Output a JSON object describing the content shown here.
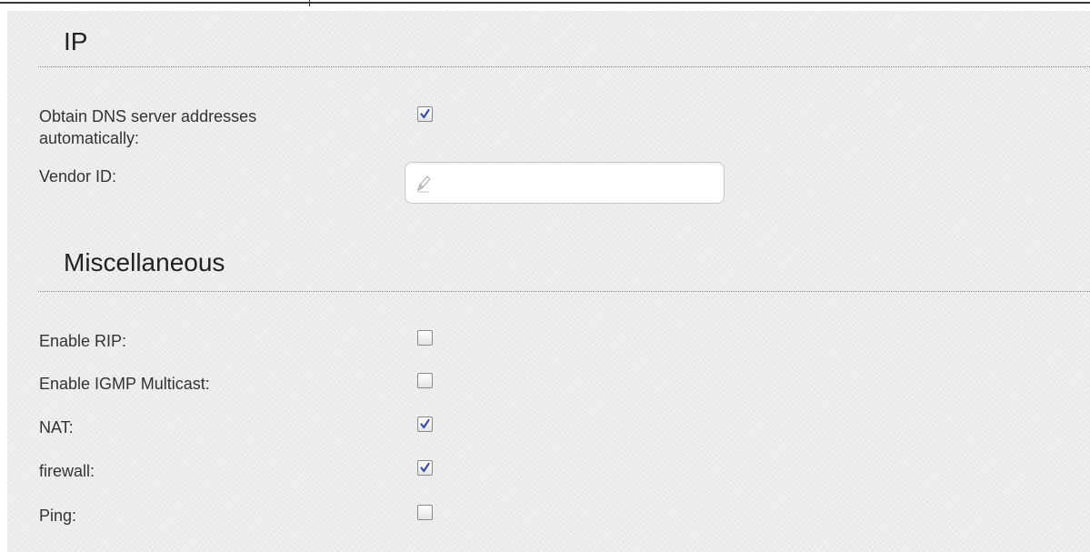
{
  "sections": {
    "ip": {
      "title": "IP",
      "dns_auto": {
        "label_line1": "Obtain DNS server addresses",
        "label_line2": "automatically:",
        "checked": true
      },
      "vendor_id": {
        "label": "Vendor ID:",
        "value": "",
        "icon": "pencil-icon"
      }
    },
    "misc": {
      "title": "Miscellaneous",
      "items": [
        {
          "label": "Enable RIP:",
          "checked": false
        },
        {
          "label": "Enable IGMP Multicast:",
          "checked": false
        },
        {
          "label": "NAT:",
          "checked": true
        },
        {
          "label": "firewall:",
          "checked": true
        },
        {
          "label": "Ping:",
          "checked": false
        }
      ]
    }
  },
  "colors": {
    "panel_background": "#ececec",
    "checkmark": "#3a4fa8",
    "separator": "#888888"
  }
}
